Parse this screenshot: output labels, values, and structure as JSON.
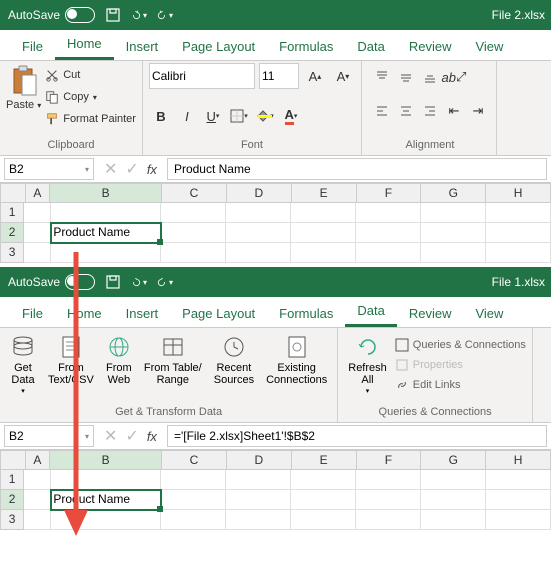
{
  "top": {
    "autosave_label": "AutoSave",
    "autosave_state": "On",
    "filename": "File 2.xlsx",
    "tabs": [
      "File",
      "Home",
      "Insert",
      "Page Layout",
      "Formulas",
      "Data",
      "Review",
      "View"
    ],
    "active_tab": "Home",
    "clipboard": {
      "paste": "Paste",
      "cut": "Cut",
      "copy": "Copy",
      "painter": "Format Painter",
      "group": "Clipboard"
    },
    "font": {
      "name": "Calibri",
      "size": "11",
      "group": "Font"
    },
    "alignment_group": "Alignment",
    "namebox": "B2",
    "formula": "Product Name",
    "cell_b2": "Product Name"
  },
  "bottom": {
    "autosave_label": "AutoSave",
    "autosave_state": "On",
    "filename": "File 1.xlsx",
    "tabs": [
      "File",
      "Home",
      "Insert",
      "Page Layout",
      "Formulas",
      "Data",
      "Review",
      "View"
    ],
    "active_tab": "Data",
    "data": {
      "get": "Get\nData",
      "csv": "From\nText/CSV",
      "web": "From\nWeb",
      "table": "From Table/\nRange",
      "recent": "Recent\nSources",
      "existing": "Existing\nConnections",
      "group1": "Get & Transform Data",
      "refresh": "Refresh\nAll",
      "queries": "Queries & Connections",
      "properties": "Properties",
      "editlinks": "Edit Links",
      "group2": "Queries & Connections"
    },
    "namebox": "B2",
    "formula": "='[File 2.xlsx]Sheet1'!$B$2",
    "cell_b2": "Product Name"
  },
  "columns": [
    "A",
    "B",
    "C",
    "D",
    "E",
    "F",
    "G",
    "H"
  ],
  "rows": [
    "1",
    "2",
    "3"
  ]
}
